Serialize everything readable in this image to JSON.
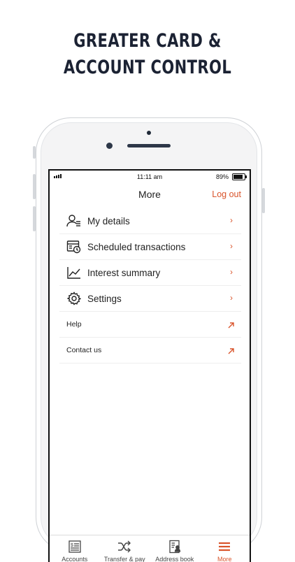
{
  "headline": {
    "line1": "GREATER CARD &",
    "line2": "ACCOUNT CONTROL"
  },
  "status_bar": {
    "time": "11:11 am",
    "battery_percent": "89%",
    "battery_level": 0.89
  },
  "nav": {
    "title": "More",
    "logout_label": "Log out"
  },
  "menu": {
    "items": [
      {
        "label": "My details",
        "icon": "user-details-icon"
      },
      {
        "label": "Scheduled transactions",
        "icon": "scheduled-calendar-icon"
      },
      {
        "label": "Interest summary",
        "icon": "line-chart-icon"
      },
      {
        "label": "Settings",
        "icon": "gear-icon"
      },
      {
        "label": "Help",
        "icon": "external-arrow-icon"
      },
      {
        "label": "Contact us",
        "icon": "external-arrow-icon"
      }
    ],
    "chevron": "›"
  },
  "tabbar": {
    "items": [
      {
        "label": "Accounts",
        "icon": "accounts-icon"
      },
      {
        "label": "Transfer & pay",
        "icon": "shuffle-icon"
      },
      {
        "label": "Address book",
        "icon": "address-book-icon"
      },
      {
        "label": "More",
        "icon": "hamburger-menu-icon",
        "active": true
      }
    ]
  },
  "colors": {
    "accent": "#d9542b",
    "headline": "#1b2233",
    "text": "#222222"
  }
}
